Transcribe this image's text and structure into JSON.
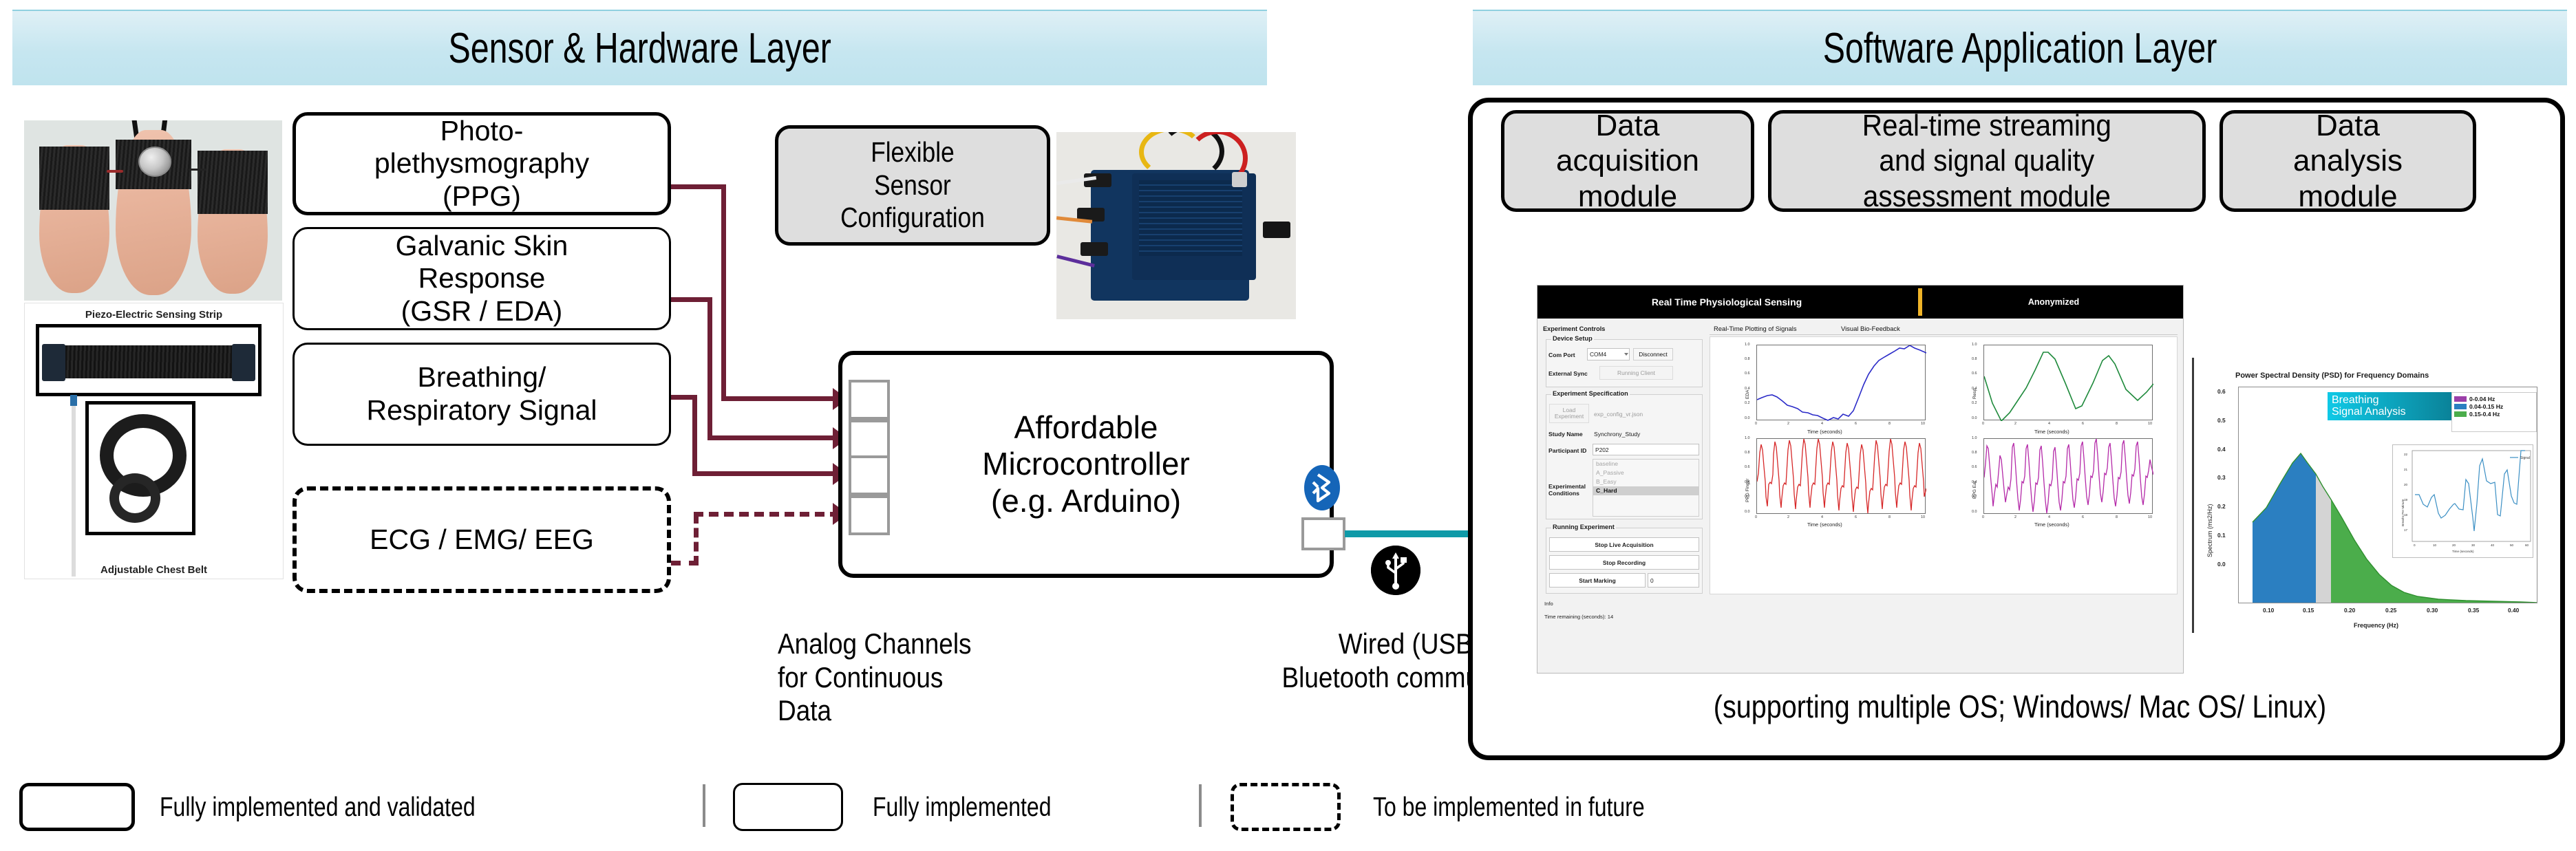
{
  "layers": {
    "hardware": {
      "title": "Sensor & Hardware Layer"
    },
    "software": {
      "title": "Software Application Layer"
    }
  },
  "sensors": [
    {
      "id": "ppg",
      "label": "Photo-\nplethysmography\n(PPG)",
      "style": "thick"
    },
    {
      "id": "gsr",
      "label": "Galvanic Skin\nResponse\n(GSR / EDA)",
      "style": "thin"
    },
    {
      "id": "resp",
      "label": "Breathing/\nRespiratory Signal",
      "style": "thin"
    },
    {
      "id": "ecg",
      "label": "ECG / EMG/ EEG",
      "style": "dashed"
    }
  ],
  "hardware": {
    "flexible_config_label": "Flexible\nSensor\nConfiguration",
    "microcontroller_label": "Affordable\nMicrocontroller\n(e.g. Arduino)",
    "analog_note": "Analog Channels\nfor Continuous\nData",
    "comm_note": "Wired (USB) or\nBluetooth communication",
    "photo_captions": {
      "strip": "Piezo-Electric Sensing Strip",
      "belt": "Adjustable Chest Belt"
    },
    "icons": {
      "bluetooth": "bluetooth-icon",
      "usb": "usb-icon"
    }
  },
  "software": {
    "modules": [
      {
        "id": "acq",
        "label": "Data\nacquisition\nmodule"
      },
      {
        "id": "stream",
        "label": "Real-time streaming\nand signal quality\nassessment module"
      },
      {
        "id": "analysis",
        "label": "Data\nanalysis\nmodule"
      }
    ],
    "os_note": "(supporting multiple OS; Windows/ Mac OS/ Linux)"
  },
  "app": {
    "window_title": "Real Time Physiological Sensing",
    "anonymized_label": "Anonymized",
    "panels": {
      "experiment_controls": "Experiment Controls",
      "device_setup": "Device Setup",
      "experiment_specification": "Experiment Specification",
      "running_experiment": "Running Experiment",
      "info": "Info"
    },
    "fields": {
      "com_port_label": "Com Port",
      "com_port_value": "COM4",
      "disconnect_button": "Disconnect",
      "external_sync_label": "External Sync",
      "external_sync_value": "Running Client",
      "load_experiment_button": "Load\nExperiment",
      "config_file": "exp_config_vr.json",
      "study_name_label": "Study Name",
      "study_name_value": "Synchrony_Study",
      "participant_id_label": "Participant ID",
      "participant_id_value": "P202",
      "experimental_conditions_label": "Experimental\nConditions"
    },
    "conditions": [
      "baseline",
      "A_Passive",
      "B_Easy",
      "C_Hard"
    ],
    "selected_condition": "C_Hard",
    "buttons": {
      "stop_live_acquisition": "Stop Live Acquisition",
      "stop_recording": "Stop Recording",
      "start_marking": "Start Marking",
      "marker_count": "0"
    },
    "status": "Time remaining (seconds): 14",
    "tabs": [
      {
        "id": "plot",
        "label": "Real-Time Plotting of Signals",
        "active": true
      },
      {
        "id": "biofeedback",
        "label": "Visual Bio-Feedback",
        "active": false
      }
    ]
  },
  "chart_data": [
    {
      "type": "line",
      "id": "eda",
      "title": "",
      "xlabel": "Time (seconds)",
      "ylabel": "EDA",
      "xlim": [
        0,
        10
      ],
      "ylim": [
        0.0,
        1.0
      ],
      "xticks": [
        "0",
        "2",
        "4",
        "6",
        "8",
        "10"
      ],
      "yticks": [
        "0.0",
        "0.2",
        "0.4",
        "0.6",
        "0.8",
        "1.0"
      ],
      "color": "#2b2bc8",
      "x": [
        0,
        0.3,
        0.6,
        0.9,
        1.2,
        1.5,
        1.8,
        2.1,
        2.4,
        2.7,
        3.0,
        3.3,
        3.6,
        3.9,
        4.2,
        4.5,
        4.8,
        5.1,
        5.4,
        5.7,
        6.0,
        6.3,
        6.6,
        6.9,
        7.2,
        7.5,
        7.8,
        8.1,
        8.4,
        8.7,
        9.0,
        9.3,
        9.6,
        10.0
      ],
      "y": [
        0.28,
        0.31,
        0.34,
        0.35,
        0.32,
        0.26,
        0.21,
        0.18,
        0.16,
        0.12,
        0.11,
        0.08,
        0.07,
        0.04,
        0.01,
        0.05,
        0.03,
        0.09,
        0.06,
        0.14,
        0.32,
        0.48,
        0.62,
        0.73,
        0.8,
        0.85,
        0.88,
        0.92,
        0.96,
        0.95,
        1.0,
        0.96,
        0.94,
        0.9
      ]
    },
    {
      "type": "line",
      "id": "resp",
      "xlabel": "Time (seconds)",
      "ylabel": "Resp",
      "xlim": [
        0,
        10
      ],
      "ylim": [
        0.0,
        1.0
      ],
      "xticks": [
        "0",
        "2",
        "4",
        "6",
        "8",
        "10"
      ],
      "yticks": [
        "0.0",
        "0.2",
        "0.4",
        "0.6",
        "0.8",
        "1.0"
      ],
      "color": "#1f8a3c",
      "x": [
        0,
        0.5,
        1.0,
        1.5,
        2.0,
        2.5,
        3.0,
        3.5,
        3.8,
        4.2,
        4.8,
        5.4,
        5.8,
        6.4,
        7.0,
        7.4,
        7.8,
        8.4,
        9.1,
        9.6,
        10.0
      ],
      "y": [
        0.59,
        0.24,
        0.0,
        0.11,
        0.27,
        0.44,
        0.67,
        0.87,
        0.91,
        0.82,
        0.5,
        0.16,
        0.2,
        0.5,
        0.8,
        0.86,
        0.75,
        0.42,
        0.27,
        0.38,
        0.49
      ]
    },
    {
      "type": "line",
      "id": "ppg_finger",
      "xlabel": "Time (seconds)",
      "ylabel": "PPG Finger",
      "xlim": [
        0,
        10
      ],
      "ylim": [
        0.0,
        1.0
      ],
      "xticks": [
        "0",
        "2",
        "4",
        "6",
        "8",
        "10"
      ],
      "yticks": [
        "0.0",
        "0.2",
        "0.4",
        "0.6",
        "0.8",
        "1.0"
      ],
      "color": "#d62728",
      "period": 0.62,
      "peak": 1.0,
      "trough": 0.03,
      "note": "Quasi-periodic pulse waveform, ~16 beats over 10 s"
    },
    {
      "type": "line",
      "id": "ppg_ear",
      "xlabel": "Time (seconds)",
      "ylabel": "PPG Ear",
      "xlim": [
        0,
        10
      ],
      "ylim": [
        0.0,
        1.0
      ],
      "xticks": [
        "0",
        "2",
        "4",
        "6",
        "8",
        "10"
      ],
      "yticks": [
        "0.0",
        "0.2",
        "0.4",
        "0.6",
        "0.8",
        "1.0"
      ],
      "color": "#b429a8",
      "period": 0.62,
      "peak": 1.0,
      "trough": 0.02,
      "note": "Quasi-periodic pulse waveform, ~16 beats over 10 s"
    },
    {
      "type": "area",
      "id": "psd",
      "title": "Power Spectral Density (PSD) for Frequency Domains",
      "xlabel": "Frequency (Hz)",
      "ylabel": "Spectrum (ms2/Hz)",
      "xlim": [
        0.06,
        0.4
      ],
      "ylim": [
        0.0,
        0.68
      ],
      "xticks": [
        "0.10",
        "0.15",
        "0.20",
        "0.25",
        "0.30",
        "0.35",
        "0.40"
      ],
      "yticks": [
        "0.0",
        "0.1",
        "0.2",
        "0.3",
        "0.4",
        "0.5",
        "0.6"
      ],
      "badge": "Breathing\nSignal Analysis",
      "legend": [
        {
          "label": "0-0.04 Hz",
          "color": "#9b3fa8"
        },
        {
          "label": "0.04-0.15 Hz",
          "color": "#2b7fc1"
        },
        {
          "label": "0.15-0.4 Hz",
          "color": "#4bad4b"
        }
      ],
      "x": [
        0.065,
        0.08,
        0.095,
        0.11,
        0.12,
        0.135,
        0.15,
        0.16,
        0.175,
        0.19,
        0.205,
        0.22,
        0.235,
        0.25,
        0.28,
        0.32,
        0.36,
        0.4
      ],
      "y": [
        0.255,
        0.4,
        0.555,
        0.625,
        0.645,
        0.595,
        0.52,
        0.49,
        0.38,
        0.26,
        0.155,
        0.075,
        0.03,
        0.015,
        0.008,
        0.005,
        0.003,
        0.002
      ],
      "bands": [
        {
          "range": [
            0.065,
            0.141
          ],
          "color": "#2b7fc1"
        },
        {
          "range": [
            0.141,
            0.156
          ],
          "color": "#d4d4d4"
        },
        {
          "range": [
            0.156,
            0.4
          ],
          "color": "#4bad4b"
        }
      ],
      "inset": {
        "type": "line",
        "xlabel": "Time (seconds)",
        "ylabel": "Breaths Per Minute",
        "legend": [
          "Signal"
        ],
        "xlim": [
          0,
          60
        ],
        "ylim": [
          16.3,
          22.4
        ],
        "xticks": [
          "0",
          "10",
          "20",
          "30",
          "40",
          "50",
          "60"
        ],
        "yticks": [
          "17",
          "18",
          "19",
          "20",
          "21",
          "22"
        ],
        "color": "#3b8fc4",
        "x": [
          0,
          3,
          5,
          7,
          9,
          10,
          12,
          13,
          15,
          17,
          19,
          20,
          22,
          24,
          26,
          27,
          29,
          30,
          31,
          32,
          33,
          35,
          37,
          39,
          41,
          42,
          44,
          45,
          47,
          49,
          51,
          52,
          54,
          56
        ],
        "y": [
          18.65,
          18.65,
          18.0,
          17.85,
          18.4,
          18.6,
          17.4,
          17.15,
          17.35,
          17.7,
          18.0,
          18.05,
          17.7,
          17.65,
          19.7,
          19.4,
          17.3,
          16.5,
          18.3,
          20.8,
          21.4,
          19.9,
          19.75,
          19.8,
          17.9,
          17.8,
          19.6,
          19.8,
          18.6,
          18.15,
          18.0,
          18.0,
          22.3,
          22.3
        ]
      }
    }
  ],
  "legend": [
    {
      "id": "validated",
      "label": "Fully implemented and validated",
      "style": "thick"
    },
    {
      "id": "implemented",
      "label": "Fully implemented",
      "style": "thin"
    },
    {
      "id": "future",
      "label": "To be implemented in future",
      "style": "dashed"
    }
  ],
  "colors": {
    "banner": "#c6e6f0",
    "wire": "#6e1f35",
    "teal": "#0f9aa8",
    "bluetooth": "#1565b8",
    "module_fill": "#dedede"
  }
}
